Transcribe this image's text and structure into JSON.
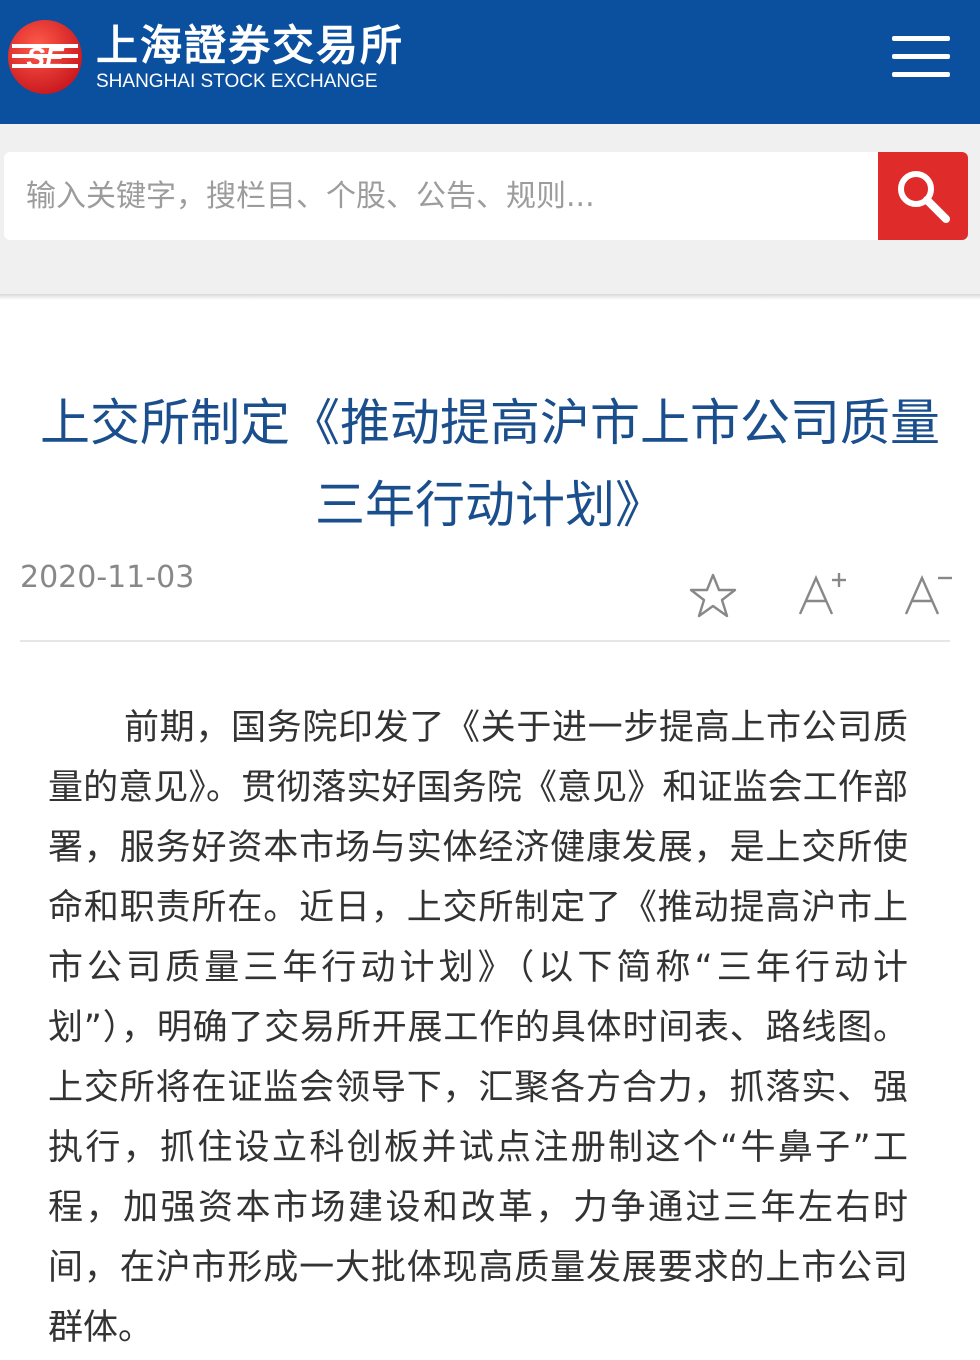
{
  "header": {
    "logo_cn": "上海證券交易所",
    "logo_en": "SHANGHAI STOCK EXCHANGE",
    "logo_mark_text": "SE",
    "menu_icon": "hamburger-menu-icon",
    "brand_color": "#0b4f9f"
  },
  "search": {
    "placeholder": "输入关键字，搜栏目、个股、公告、规则...",
    "button_icon": "search-icon",
    "button_color": "#e02b2b"
  },
  "article": {
    "title": "上交所制定《推动提高沪市上市公司质量三年行动计划》",
    "date": "2020-11-03",
    "tools": [
      "star-icon",
      "font-increase-icon",
      "font-decrease-icon"
    ],
    "body": "前期，国务院印发了《关于进一步提高上市公司质量的意见》。贯彻落实好国务院《意见》和证监会工作部署，服务好资本市场与实体经济健康发展，是上交所使命和职责所在。近日，上交所制定了《推动提高沪市上市公司质量三年行动计划》（以下简称“三年行动计划”），明确了交易所开展工作的具体时间表、路线图。上交所将在证监会领导下，汇聚各方合力，抓落实、强执行，抓住设立科创板并试点注册制这个“牛鼻子”工程，加强资本市场建设和改革，力争通过三年左右时间，在沪市形成一大批体现高质量发展要求的上市公司群体。",
    "title_color": "#1a4e8c"
  }
}
